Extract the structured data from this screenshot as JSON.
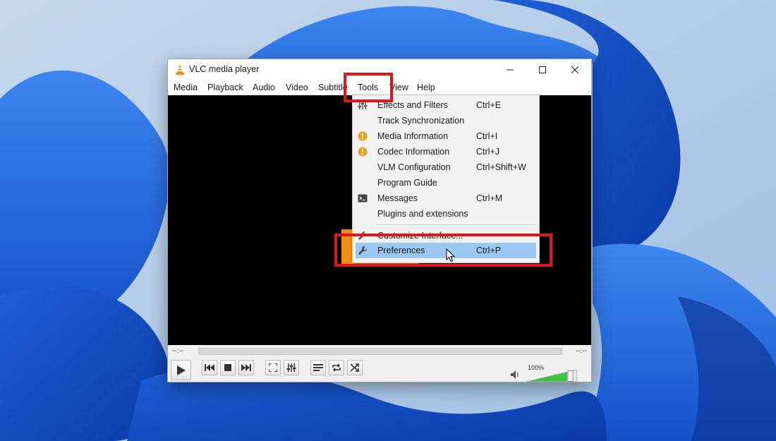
{
  "window": {
    "title": "VLC media player"
  },
  "menubar": {
    "items": [
      "Media",
      "Playback",
      "Audio",
      "Video",
      "Subtitle",
      "Tools",
      "View",
      "Help"
    ]
  },
  "tools_menu": {
    "items": [
      {
        "label": "Effects and Filters",
        "shortcut": "Ctrl+E",
        "icon": "equalizer-icon"
      },
      {
        "label": "Track Synchronization",
        "shortcut": "",
        "icon": ""
      },
      {
        "label": "Media Information",
        "shortcut": "Ctrl+I",
        "icon": "info-icon"
      },
      {
        "label": "Codec Information",
        "shortcut": "Ctrl+J",
        "icon": "info-icon"
      },
      {
        "label": "VLM Configuration",
        "shortcut": "Ctrl+Shift+W",
        "icon": ""
      },
      {
        "label": "Program Guide",
        "shortcut": "",
        "icon": ""
      },
      {
        "label": "Messages",
        "shortcut": "Ctrl+M",
        "icon": "terminal-icon"
      },
      {
        "label": "Plugins and extensions",
        "shortcut": "",
        "icon": ""
      },
      {
        "label": "Customize Interface...",
        "shortcut": "",
        "icon": "wrench-icon"
      },
      {
        "label": "Preferences",
        "shortcut": "Ctrl+P",
        "icon": "wrench-icon"
      }
    ],
    "highlighted": "Preferences"
  },
  "player": {
    "time_elapsed": "--:--",
    "time_total": "--:--",
    "volume_label": "100%",
    "volume_level": 1.0
  },
  "colors": {
    "highlight_box": "#e2141b",
    "menu_hover": "#99c9f2",
    "vlc_orange": "#f28c13",
    "volume_green": "#3ec43e"
  }
}
